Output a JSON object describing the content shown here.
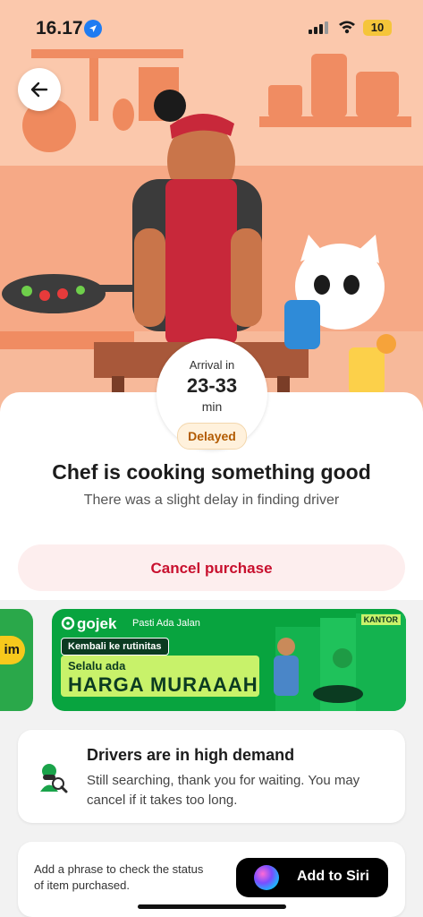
{
  "status_bar": {
    "time": "16.17",
    "battery": "10"
  },
  "arrival": {
    "label": "Arrival in",
    "time": "23-33",
    "unit": "min",
    "badge": "Delayed"
  },
  "heading": {
    "title": "Chef is cooking something good",
    "subtitle": "There was a slight delay in finding driver"
  },
  "actions": {
    "cancel_label": "Cancel purchase"
  },
  "promo": {
    "left_pill": "im",
    "brand": "gojek",
    "tagline": "Pasti Ada Jalan",
    "tag": "Kembali ke rutinitas",
    "line1": "Selalu ada",
    "line2": "HARGA MURAAAH",
    "sign": "KANTOR"
  },
  "demand_card": {
    "title": "Drivers are in high demand",
    "body": "Still searching, thank you for waiting. You may cancel if it takes too long."
  },
  "siri_card": {
    "text": "Add a phrase to check the status of item purchased.",
    "button_label": "Add to Siri"
  },
  "colors": {
    "hero_bg": "#fbc8ac",
    "accent_red": "#c8102e",
    "gojek_green": "#08a43f",
    "badge_text": "#b25a00"
  }
}
